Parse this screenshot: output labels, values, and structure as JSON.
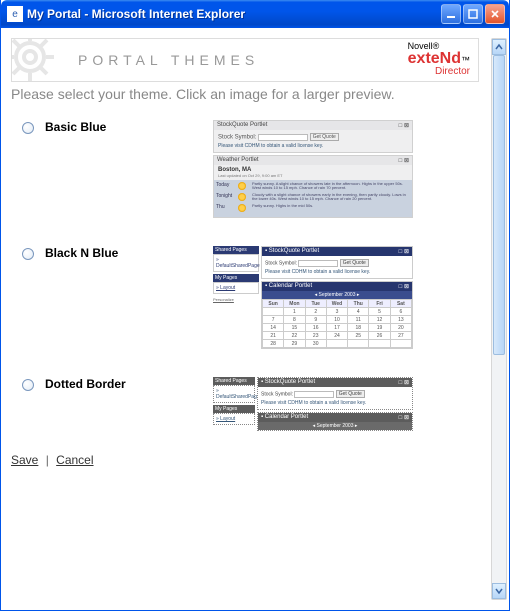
{
  "window": {
    "title": "My Portal - Microsoft Internet Explorer"
  },
  "banner": {
    "title": "PORTAL THEMES",
    "brand_top": "Novell®",
    "brand_mid": "exteNd",
    "brand_tm": "™",
    "brand_bottom": "Director"
  },
  "intro": "Please select your theme. Click an image for a larger preview.",
  "themes": [
    {
      "name": "Basic Blue"
    },
    {
      "name": "Black N Blue"
    },
    {
      "name": "Dotted Border"
    }
  ],
  "preview1": {
    "p1_title": "StockQuote Portlet",
    "p1_label": "Stock Symbol:",
    "p1_btn": "Get Quote",
    "p1_note": "Please visit CDHM to obtain a valid license key.",
    "p2_title": "Weather Portlet",
    "city": "Boston, MA",
    "updated": "Last updated on Oct 29, 9:00 am ET",
    "rows": [
      {
        "day": "Today",
        "text": "Partly sunny. A slight chance of showers late in the afternoon. Highs in the upper 50s. West winds 10 to 15 mph. Chance of rain 70 percent."
      },
      {
        "day": "Tonight",
        "text": "Cloudy with a slight chance of showers early in the evening, then partly cloudy. Lows in the lower 40s. West winds 10 to 15 mph. Chance of rain 20 percent."
      },
      {
        "day": "Thu",
        "text": "Partly sunny. Highs in the mid 50s."
      }
    ]
  },
  "preview2": {
    "side_title": "Shared Pages",
    "side_sub": "» DefaultSharedPage",
    "side_my": "My Pages",
    "side_layout": "» Layout",
    "side_personalize": "Personalize",
    "p1_title": "▪ StockQuote Portlet",
    "p1_label": "Stock Symbol:",
    "p1_btn": "Get Quote",
    "p1_note": "Please visit CDHM to obtain a valid license key.",
    "p2_title": "▪ Calendar Portlet",
    "cal_title": "September 2003",
    "cal_days": [
      "Sun",
      "Mon",
      "Tue",
      "Wed",
      "Thu",
      "Fri",
      "Sat"
    ],
    "cal_rows": [
      [
        "",
        "1",
        "2",
        "3",
        "4",
        "5",
        "6"
      ],
      [
        "7",
        "8",
        "9",
        "10",
        "11",
        "12",
        "13"
      ],
      [
        "14",
        "15",
        "16",
        "17",
        "18",
        "19",
        "20"
      ],
      [
        "21",
        "22",
        "23",
        "24",
        "25",
        "26",
        "27"
      ],
      [
        "28",
        "29",
        "30",
        "",
        "",
        "",
        ""
      ]
    ]
  },
  "preview3": {
    "side_title": "Shared Pages",
    "side_sub": "» DefaultSharedPage",
    "side_my": "My Pages",
    "side_layout": "» Layout",
    "p1_title": "▪ StockQuote Portlet",
    "p1_label": "Stock Symbol:",
    "p1_btn": "Get Quote",
    "p1_note": "Please visit CDHM to obtain a valid license key.",
    "p2_title": "▪ Calendar Portlet",
    "cal_title": "September 2003"
  },
  "actions": {
    "save": "Save",
    "cancel": "Cancel"
  }
}
